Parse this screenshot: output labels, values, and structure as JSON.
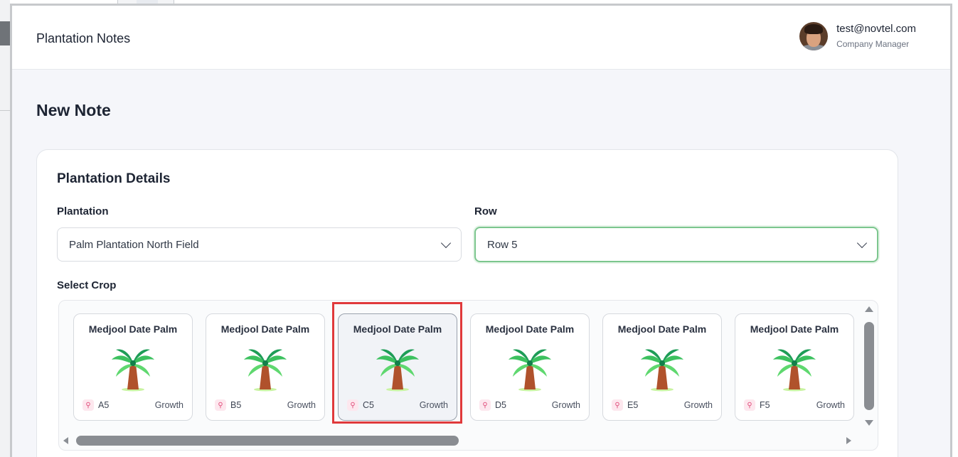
{
  "app": {
    "title": "Plantation Notes"
  },
  "user": {
    "email": "test@novtel.com",
    "role": "Company Manager",
    "avatar_icon": "user-avatar"
  },
  "page": {
    "title": "New Note"
  },
  "details": {
    "title": "Plantation Details",
    "plantation": {
      "label": "Plantation",
      "value": "Palm Plantation North Field"
    },
    "row": {
      "label": "Row",
      "value": "Row 5"
    },
    "crop_label": "Select Crop"
  },
  "crops": [
    {
      "name": "Medjool Date Palm",
      "id": "A5",
      "stage": "Growth",
      "icon": "palm-tree-icon"
    },
    {
      "name": "Medjool Date Palm",
      "id": "B5",
      "stage": "Growth",
      "icon": "palm-tree-icon"
    },
    {
      "name": "Medjool Date Palm",
      "id": "C5",
      "stage": "Growth",
      "icon": "palm-tree-icon",
      "selected": true
    },
    {
      "name": "Medjool Date Palm",
      "id": "D5",
      "stage": "Growth",
      "icon": "palm-tree-icon"
    },
    {
      "name": "Medjool Date Palm",
      "id": "E5",
      "stage": "Growth",
      "icon": "palm-tree-icon"
    },
    {
      "name": "Medjool Date Palm",
      "id": "F5",
      "stage": "Growth",
      "icon": "palm-tree-icon"
    }
  ],
  "colors": {
    "accent_green": "#7cc68e",
    "highlight_red": "#e0393b",
    "tag_pink": "#e04d7b"
  }
}
